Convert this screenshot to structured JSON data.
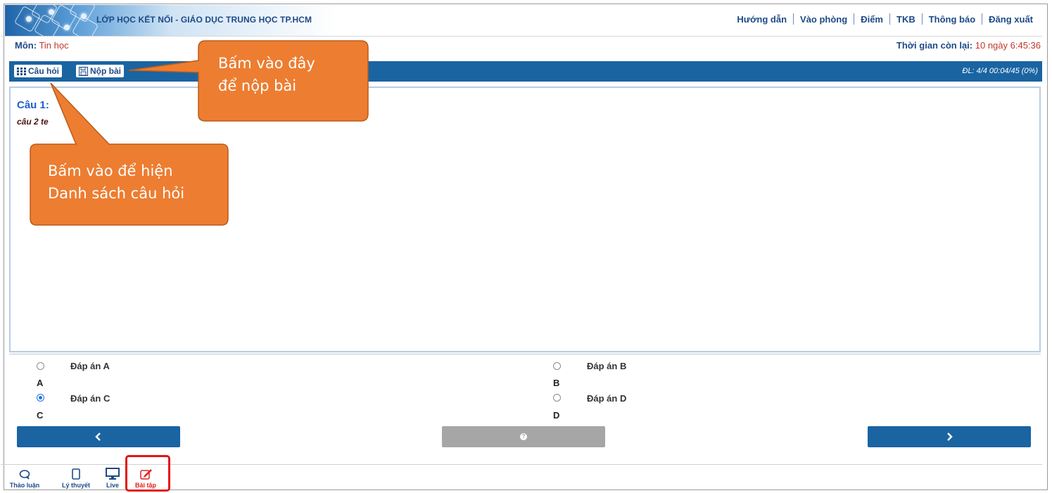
{
  "header": {
    "site_title": "LỚP HỌC KẾT NỐI -  GIÁO DỤC TRUNG HỌC TP.HCM",
    "nav": [
      "Hướng dẫn",
      "Vào phòng",
      "Điểm",
      "TKB",
      "Thông báo",
      "Đăng xuất"
    ]
  },
  "subject": {
    "label": "Môn:",
    "value": "Tin học"
  },
  "time_left": {
    "label": "Thời gian còn lại:",
    "value": "10 ngày 6:45:36"
  },
  "toolbar": {
    "questions_label": "Câu hỏi",
    "submit_label": "Nộp bài",
    "status": "ĐL: 4/4   00:04/45 (0%)"
  },
  "question": {
    "title": "Câu 1:",
    "text": "câu 2 te"
  },
  "answers": [
    {
      "label": "Đáp án A",
      "letter": "A",
      "selected": false
    },
    {
      "label": "Đáp án B",
      "letter": "B",
      "selected": false
    },
    {
      "label": "Đáp án C",
      "letter": "C",
      "selected": true
    },
    {
      "label": "Đáp án D",
      "letter": "D",
      "selected": false
    }
  ],
  "nav_buttons": {
    "prev_icon": "chevron-left-icon",
    "help_icon": "question-circle-icon",
    "next_icon": "chevron-right-icon"
  },
  "bottom_tabs": [
    {
      "label": "Thảo luận",
      "icon": "chat-icon"
    },
    {
      "label": "Lý thuyết",
      "icon": "tablet-icon"
    },
    {
      "label": "Live",
      "icon": "monitor-icon"
    },
    {
      "label": "Bài tập",
      "icon": "edit-icon",
      "active": true
    }
  ],
  "callouts": [
    {
      "lines": [
        "Bấm vào đây",
        "để nộp bài"
      ]
    },
    {
      "lines": [
        "Bấm vào để hiện",
        "Danh sách câu hỏi"
      ]
    }
  ],
  "colors": {
    "primary": "#1a64a2",
    "accent_red": "#c0392b",
    "callout": "#ed7d31",
    "highlight_box": "#e31414"
  }
}
